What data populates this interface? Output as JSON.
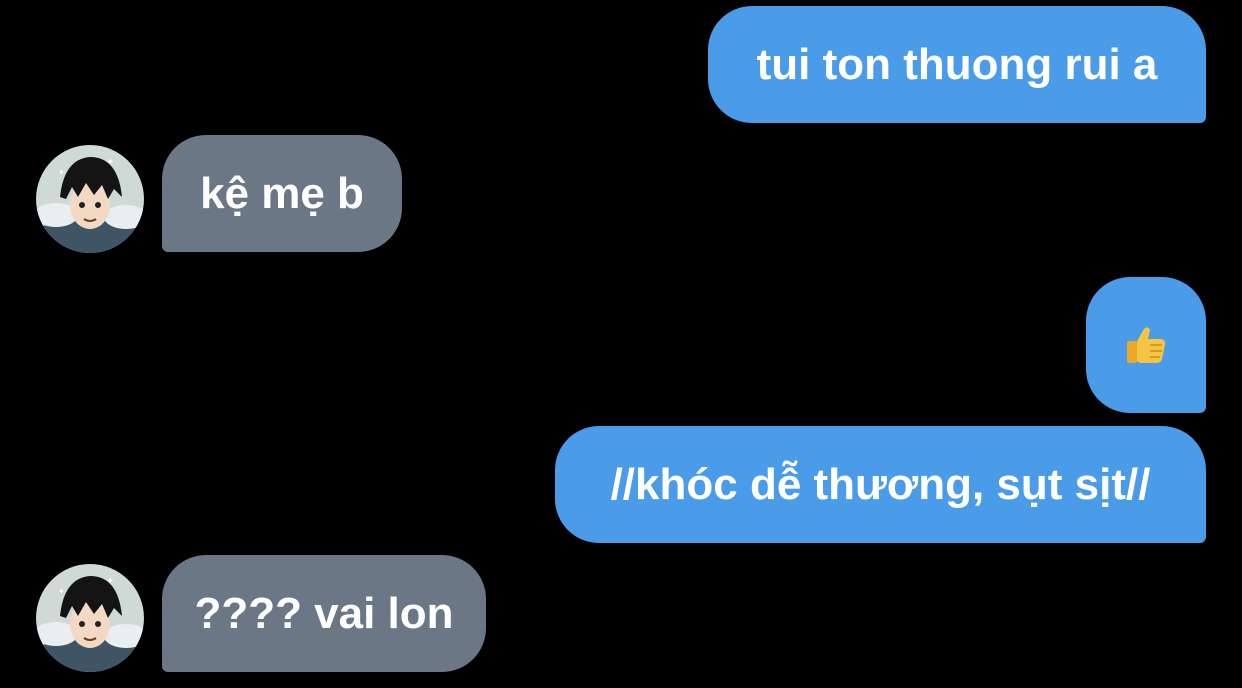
{
  "messages": [
    {
      "id": 1,
      "direction": "outgoing",
      "text": "tui ton thuong rui a"
    },
    {
      "id": 2,
      "direction": "incoming",
      "text": "kệ mẹ b",
      "avatar": "contact-avatar"
    },
    {
      "id": 3,
      "direction": "outgoing",
      "text": "",
      "icon": "thumbs-up-icon"
    },
    {
      "id": 4,
      "direction": "outgoing",
      "text": "//khóc dễ thương, sụt sịt//"
    },
    {
      "id": 5,
      "direction": "incoming",
      "text": "???? vai lon",
      "avatar": "contact-avatar"
    }
  ],
  "colors": {
    "background": "#000000",
    "outgoing_bubble": "#4a9be8",
    "incoming_bubble": "#6b7785",
    "text": "#ffffff"
  }
}
